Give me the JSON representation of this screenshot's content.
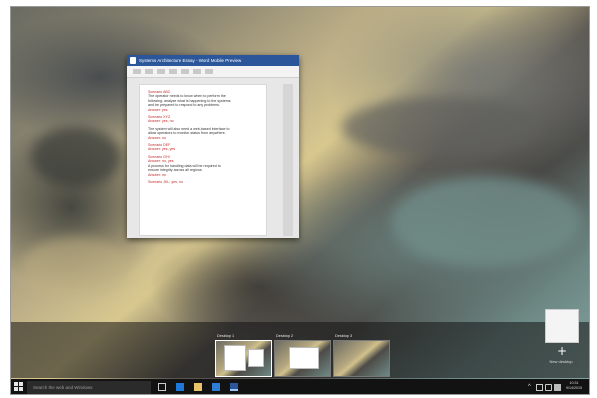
{
  "window": {
    "title": "Systems Architecture Essay - Word Mobile Preview",
    "document_lines": [
      {
        "text": "Scenario ABC",
        "tone": "red"
      },
      {
        "text": "The operator needs to know when to perform the",
        "tone": "blk"
      },
      {
        "text": "following: analyse what is happening to the systems",
        "tone": "blk"
      },
      {
        "text": "and be prepared to respond to any problems.",
        "tone": "blk"
      },
      {
        "text": "Answer: yes",
        "tone": "red"
      },
      {
        "text": "",
        "tone": "gap"
      },
      {
        "text": "Scenario XYZ",
        "tone": "red"
      },
      {
        "text": "Answer: yes, no",
        "tone": "red"
      },
      {
        "text": "",
        "tone": "gap"
      },
      {
        "text": "The system will also need a web-based interface to",
        "tone": "blk"
      },
      {
        "text": "allow operators to monitor status from anywhere.",
        "tone": "blk"
      },
      {
        "text": "Answer: no",
        "tone": "red"
      },
      {
        "text": "",
        "tone": "gap"
      },
      {
        "text": "Scenario DEF",
        "tone": "red"
      },
      {
        "text": "Answer: yes, yes",
        "tone": "red"
      },
      {
        "text": "",
        "tone": "gap"
      },
      {
        "text": "Scenario GHI",
        "tone": "red"
      },
      {
        "text": "Answer: no, yes",
        "tone": "red"
      },
      {
        "text": "A process for handling data will be required to",
        "tone": "blk"
      },
      {
        "text": "ensure integrity across all regions.",
        "tone": "blk"
      },
      {
        "text": "Answer: no",
        "tone": "red"
      },
      {
        "text": "",
        "tone": "gap"
      },
      {
        "text": "Scenario JKL: yes, no",
        "tone": "red"
      }
    ]
  },
  "desktops": [
    {
      "label": "Desktop 1",
      "active": true
    },
    {
      "label": "Desktop 2",
      "active": false
    },
    {
      "label": "Desktop 3",
      "active": false
    }
  ],
  "new_desktop": {
    "plus": "+",
    "label": "New desktop"
  },
  "taskbar": {
    "search_placeholder": "Search the web and Windows",
    "clock_time": "10:31",
    "clock_date": "9/14/2015"
  },
  "colors": {
    "title_bar": "#2b579a",
    "taskbar": "#121212",
    "doc_red_text": "#c62828"
  }
}
